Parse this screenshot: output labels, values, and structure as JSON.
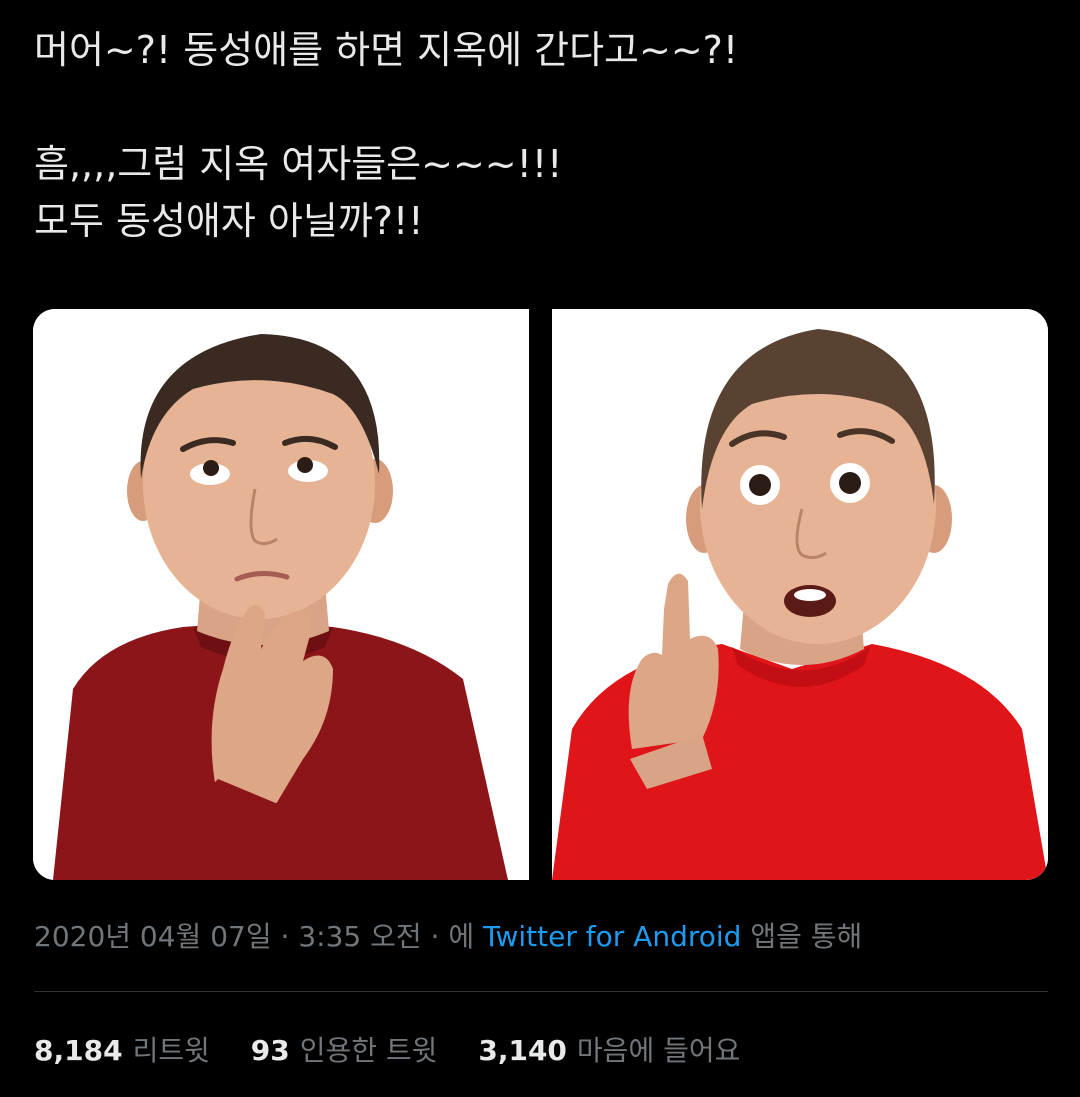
{
  "tweet": {
    "lines": [
      "머어~?! 동성애를 하면 지옥에 간다고~~?!",
      "흠,,,,그럼 지옥 여자들은~~~!!!",
      "모두 동성애자 아닐까?!!"
    ]
  },
  "media": {
    "images": [
      {
        "name": "thinking-boy-photo",
        "shirt_color": "#8b1518"
      },
      {
        "name": "surprised-boy-photo",
        "shirt_color": "#e0151a"
      }
    ]
  },
  "meta": {
    "date": "2020년 04월 07일",
    "separator": "·",
    "time": "3:35 오전",
    "via_prefix": "에",
    "source_app": "Twitter for Android",
    "via_suffix": "앱을 통해"
  },
  "stats": {
    "retweets": {
      "count": "8,184",
      "label": "리트윗"
    },
    "quotes": {
      "count": "93",
      "label": "인용한 트윗"
    },
    "likes": {
      "count": "3,140",
      "label": "마음에 들어요"
    }
  },
  "colors": {
    "background": "#000000",
    "text": "#e7e9ea",
    "muted": "#71767b",
    "link": "#1d9bf0",
    "divider": "#2f3336"
  }
}
